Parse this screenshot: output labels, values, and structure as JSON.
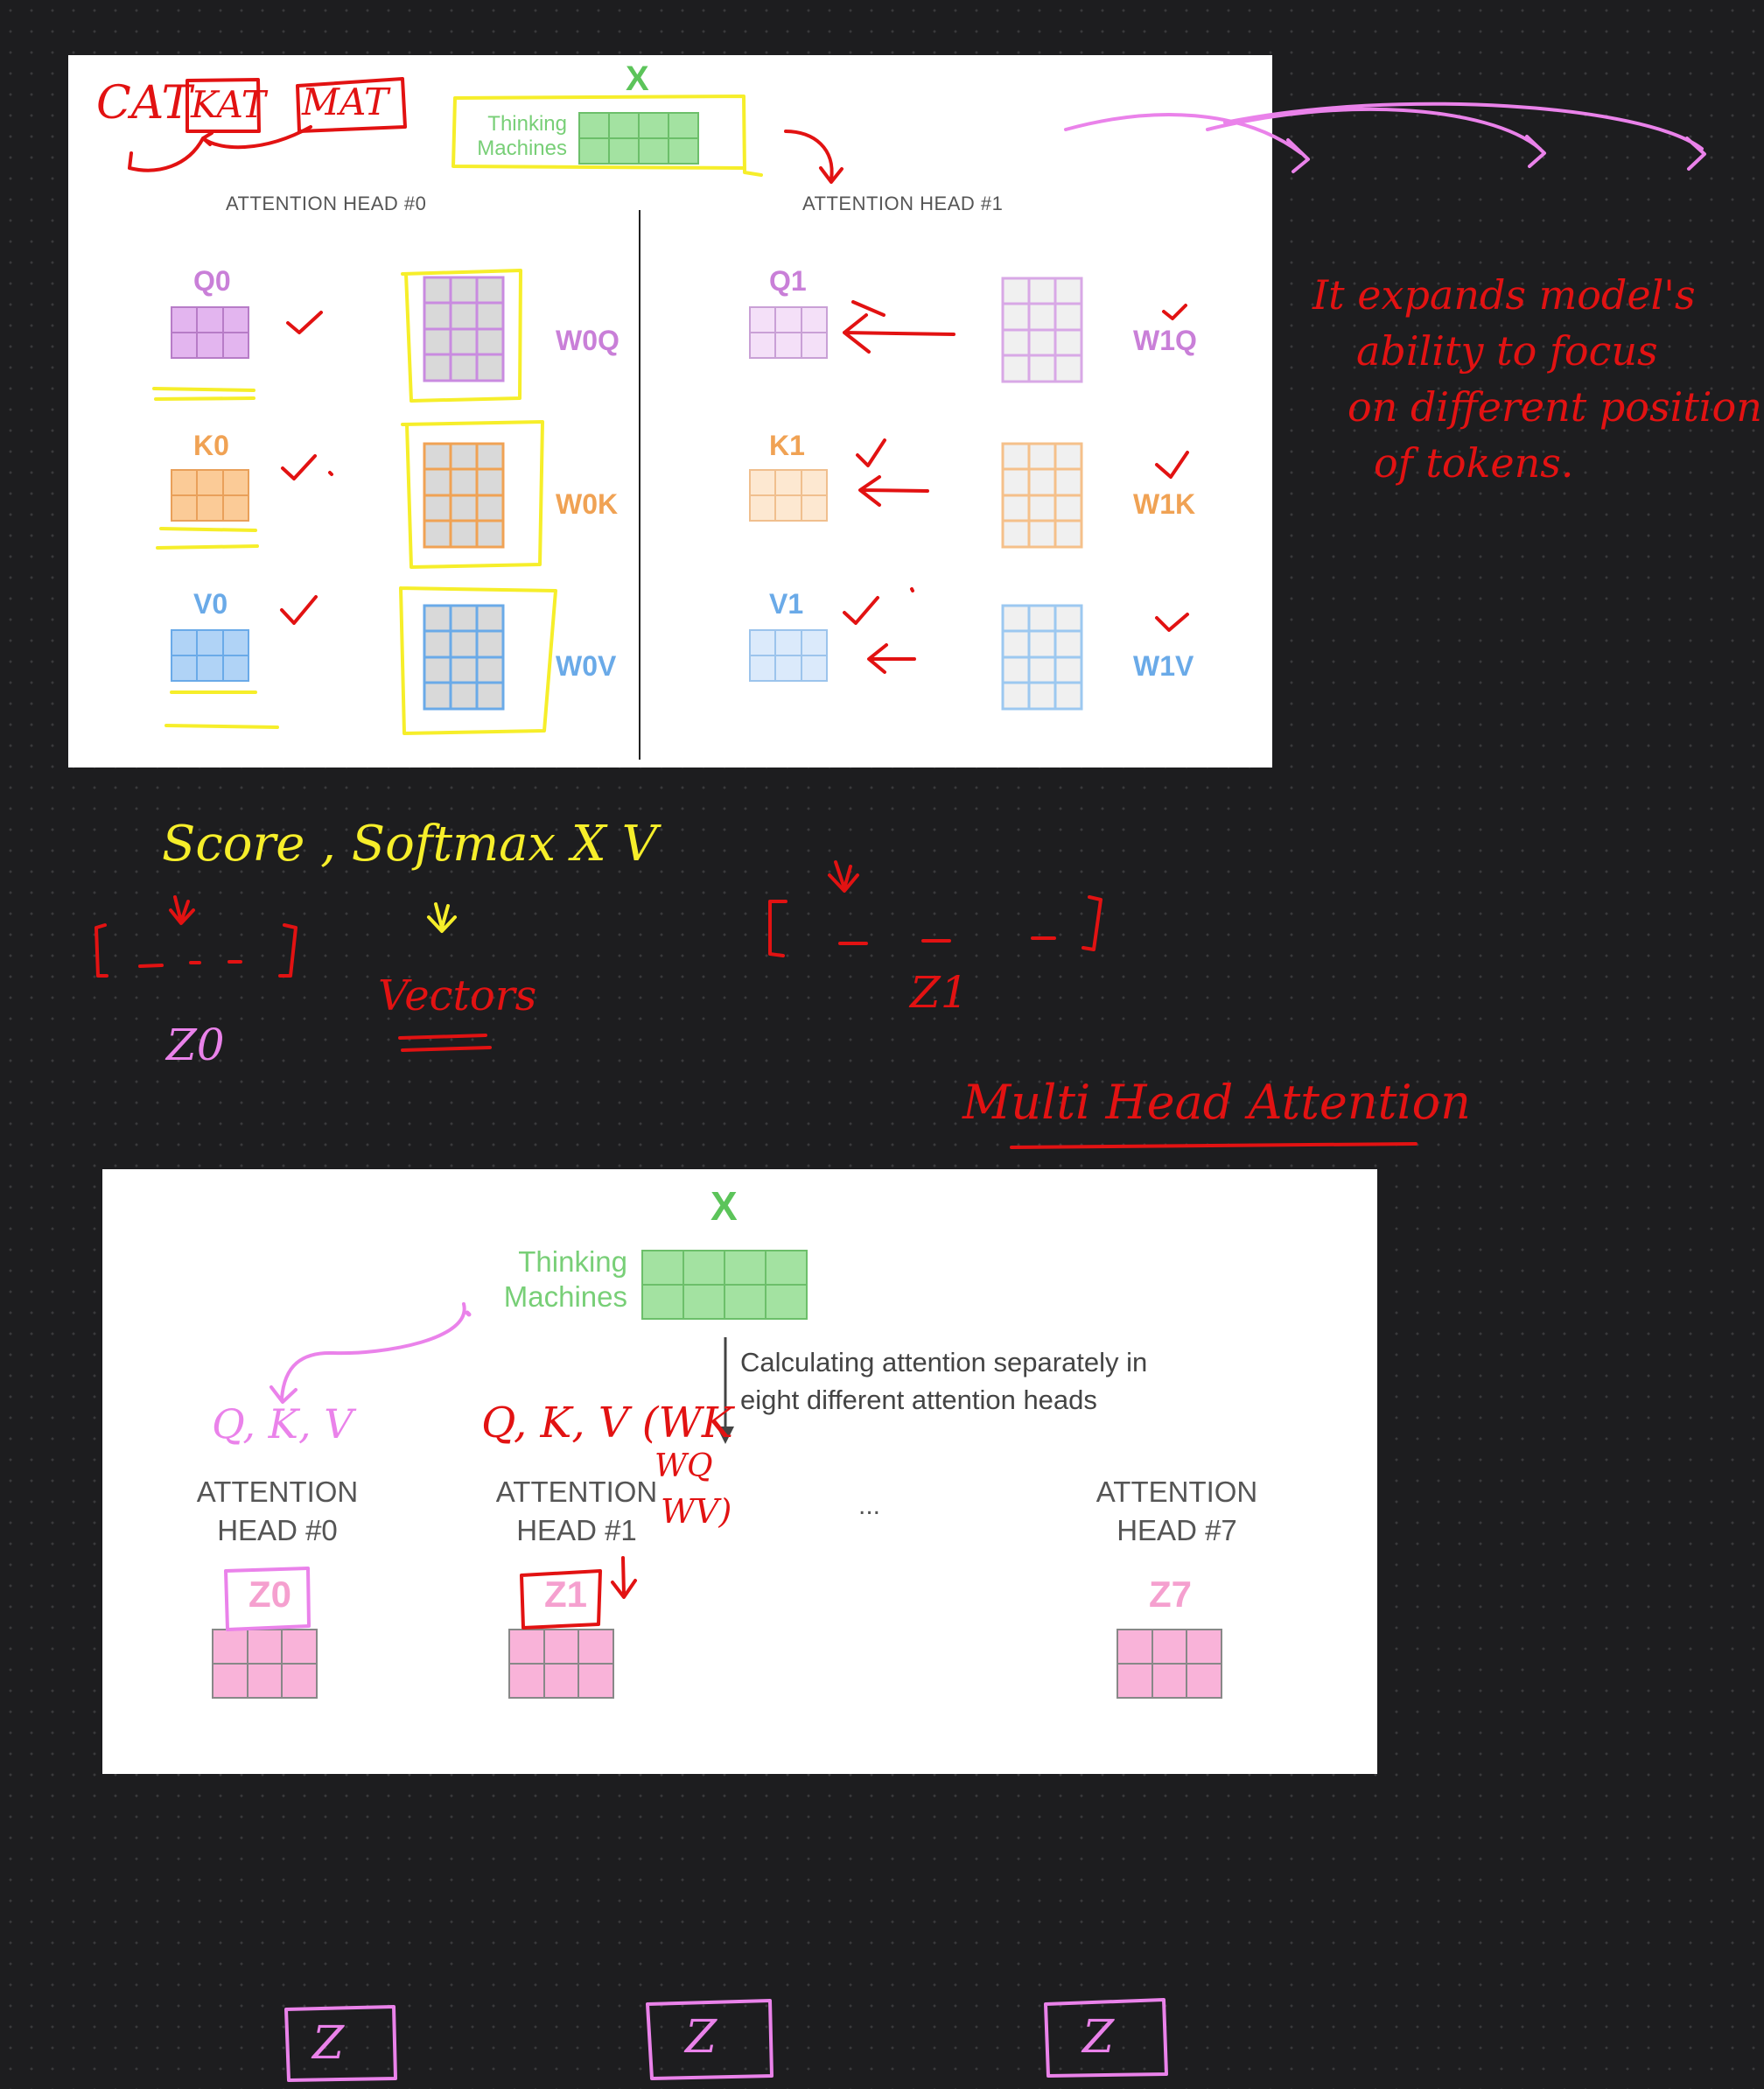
{
  "top_panel": {
    "x_label": "X",
    "input_label": "Thinking\nMachines",
    "head0_title": "ATTENTION HEAD #0",
    "head1_title": "ATTENTION HEAD #1",
    "head0": {
      "q": "Q0",
      "k": "K0",
      "v": "V0",
      "wq": "W0Q",
      "wk": "W0K",
      "wv": "W0V"
    },
    "head1": {
      "q": "Q1",
      "k": "K1",
      "v": "V1",
      "wq": "W1Q",
      "wk": "W1K",
      "wv": "W1V"
    },
    "colors": {
      "q": "#c97fd8",
      "k": "#f0a254",
      "v": "#6aaae8",
      "x": "#5cc45a"
    }
  },
  "bottom_panel": {
    "x_label": "X",
    "input_label": "Thinking\nMachines",
    "note": "Calculating attention separately in\neight different attention heads",
    "heads": [
      {
        "title": "ATTENTION\nHEAD #0",
        "z": "Z0"
      },
      {
        "title": "ATTENTION\nHEAD #1",
        "z": "Z1"
      },
      {
        "title": "ATTENTION\nHEAD #7",
        "z": "Z7"
      }
    ],
    "ellipsis": "...",
    "z_color": "#f5a0cf"
  },
  "annotations": {
    "words": {
      "car": "CAT",
      "kat": "KAT",
      "mat": "MAT"
    },
    "side_note": [
      "It expands model's",
      "ability to focus",
      "on different position",
      "of tokens."
    ],
    "score_line": "Score , Softmax X V",
    "vectors": "Vectors",
    "z0": "Z0",
    "z1": "Z1",
    "bracket0": "[ _ - - ]",
    "bracket1": "[ _  _   - ]",
    "title": "Multi Head Attention",
    "qkv_pink": "Q, K, V",
    "qkv_red": "Q, K, V (WK",
    "wq": "WQ",
    "wv": "WV)",
    "z_boxes": [
      "Z",
      "Z",
      "Z"
    ]
  }
}
